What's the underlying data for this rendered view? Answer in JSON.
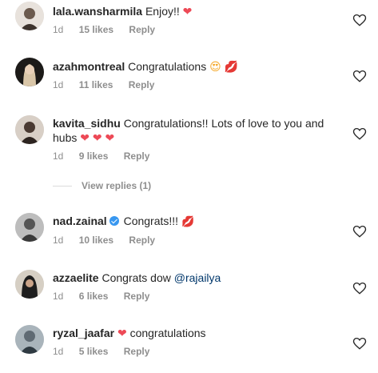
{
  "comments": [
    {
      "user": "lala.wansharmila",
      "text": "Enjoy!!",
      "emoji": "❤",
      "emoji_type": "heart",
      "time": "1d",
      "likes": "15 likes",
      "reply": "Reply",
      "avatar_color": "#6b5a4e"
    },
    {
      "user": "azahmontreal",
      "text": "Congratulations",
      "emoji": "😍 💋",
      "emoji_type": "mixed",
      "time": "1d",
      "likes": "11 likes",
      "reply": "Reply",
      "avatar_color": "#3a2f2a"
    },
    {
      "user": "kavita_sidhu",
      "text": "Congratulations!! Lots of love to you and",
      "text2": "hubs",
      "emoji": "❤ ❤ ❤",
      "emoji_type": "heart",
      "time": "1d",
      "likes": "9 likes",
      "reply": "Reply",
      "avatar_color": "#4a3a32"
    },
    {
      "user": "nad.zainal",
      "text": "Congrats!!!",
      "emoji": "💋",
      "emoji_type": "kiss",
      "verified": true,
      "time": "1d",
      "likes": "10 likes",
      "reply": "Reply",
      "avatar_color": "#8a8a8a"
    },
    {
      "user": "azzaelite",
      "text": "Congrats dow",
      "mention": "@rajailya",
      "time": "1d",
      "likes": "6 likes",
      "reply": "Reply",
      "avatar_color": "#2b2b2b"
    },
    {
      "user": "ryzal_jaafar",
      "text": "congratulations",
      "emoji": "❤",
      "emoji_type": "heart",
      "time": "1d",
      "likes": "5 likes",
      "reply": "Reply",
      "avatar_color": "#5f6a73"
    }
  ],
  "view_replies": "View replies (1)",
  "colors": {
    "text": "#262626",
    "meta": "#8e8e8e",
    "heart": "#ed4956",
    "mention": "#00376b",
    "verified": "#3897f0"
  }
}
